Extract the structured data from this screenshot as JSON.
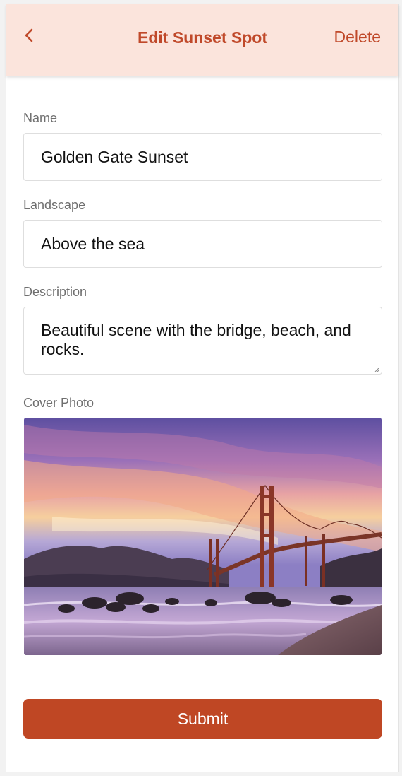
{
  "header": {
    "back_icon": "chevron-left-icon",
    "title": "Edit Sunset Spot",
    "delete_label": "Delete"
  },
  "form": {
    "name": {
      "label": "Name",
      "value": "Golden Gate Sunset"
    },
    "landscape": {
      "label": "Landscape",
      "value": "Above the sea"
    },
    "description": {
      "label": "Description",
      "value": "Beautiful scene with the bridge, beach, and rocks."
    },
    "cover_photo": {
      "label": "Cover Photo"
    }
  },
  "submit_label": "Submit",
  "colors": {
    "accent": "#c0492a",
    "header_bg": "#fbe4dc",
    "button_bg": "#bf4724"
  }
}
